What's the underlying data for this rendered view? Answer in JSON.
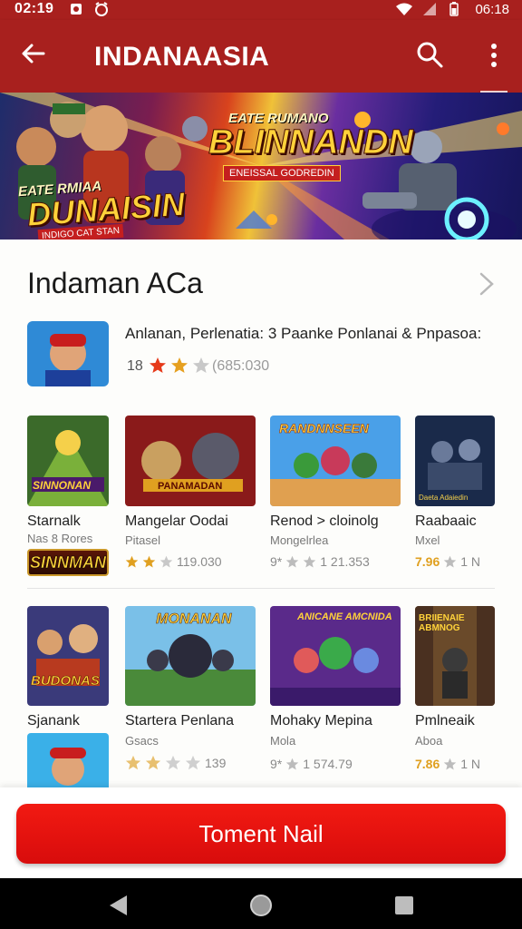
{
  "status_bar": {
    "time": "02:19",
    "right_time": "06:18"
  },
  "app_bar": {
    "title": "INDANAASIA"
  },
  "banner": {
    "left_small": "EATE RMIAA",
    "left_big": "DUNAISIN",
    "left_tag": "INDIGO CAT STAN",
    "right_small": "EATE RUMANO",
    "right_big": "BLINNANDN",
    "right_tag": "ENEISSAL GODREDIN"
  },
  "section": {
    "title": "Indaman ACa",
    "featured": {
      "description": "Anlanan, Perlenatia: 3 Paanke Ponlanai & Pnpasoa:",
      "rating": "18",
      "count": "(685:030"
    }
  },
  "row1": [
    {
      "name": "Starnalk",
      "sub": "Nas 8 Rores",
      "rating": "",
      "count": "",
      "thumb_label": "SINNONAN"
    },
    {
      "name": "Mangelar Oodai",
      "sub": "Pitasel",
      "rating": "",
      "count": "119.030",
      "thumb_label": "PANAMADAN"
    },
    {
      "name": "Renod > cloinolg",
      "sub": "Mongelrlea",
      "rating": "9*",
      "count": "1 21.353",
      "thumb_label": "RANDNNSEEN"
    },
    {
      "name": "Raabaaic",
      "sub": "Mxel",
      "rating": "7.96",
      "count": "1 N",
      "thumb_label": "Daeta Adaiedin"
    }
  ],
  "row1_mini": {
    "label": "SINNMAN"
  },
  "row2": [
    {
      "name": "Sjanank",
      "sub": "",
      "rating": "",
      "count": "",
      "thumb_label": "BUDONAS"
    },
    {
      "name": "Startera Penlana",
      "sub": "Gsacs",
      "rating": "",
      "count": "139",
      "thumb_label": "MONANAN"
    },
    {
      "name": "Mohaky Mepina",
      "sub": "Mola",
      "rating": "9*",
      "count": "1 574.79",
      "thumb_label": "ANICANE AMCNIDA"
    },
    {
      "name": "Pmlneaik",
      "sub": "Aboa",
      "rating": "7.86",
      "count": "1 N",
      "thumb_label": "BRIIENAIE ABMNOG"
    }
  ],
  "cta": {
    "label": "Toment Nail"
  },
  "colors": {
    "primary": "#a8201e",
    "cta": "#e8140e",
    "star": "#e0a020"
  }
}
